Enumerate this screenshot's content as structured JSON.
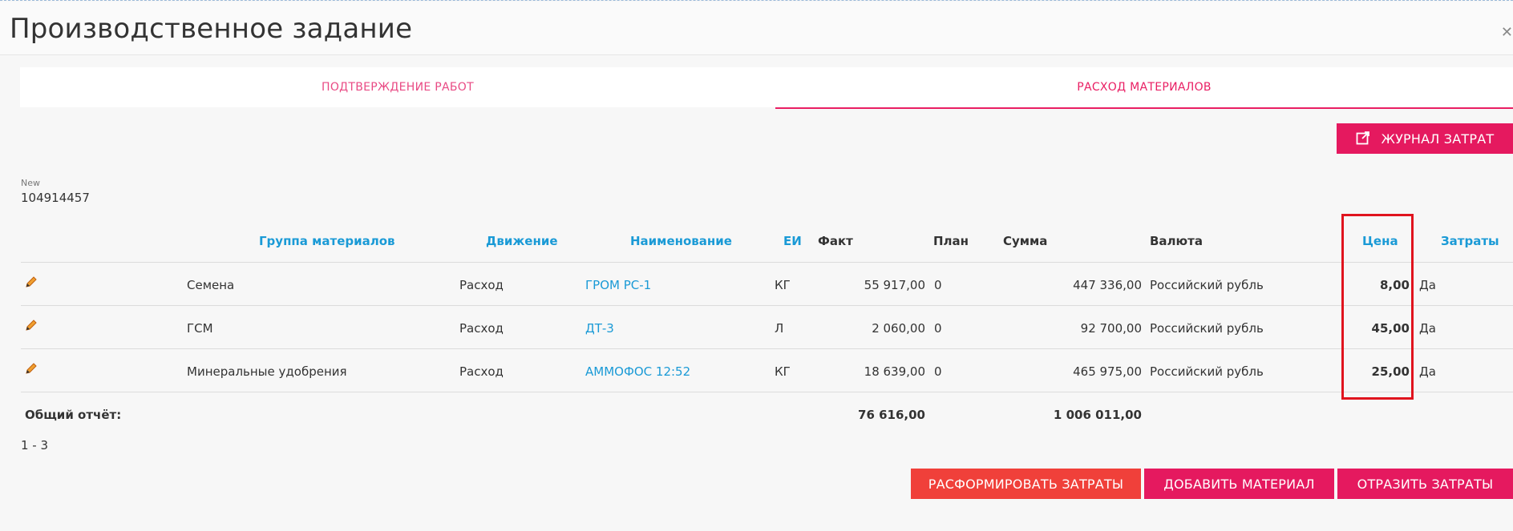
{
  "page": {
    "title": "Производственное задание"
  },
  "tabs": [
    {
      "label": "ПОДТВЕРЖДЕНИЕ РАБОТ"
    },
    {
      "label": "РАСХОД МАТЕРИАЛОВ"
    }
  ],
  "toolbar": {
    "journal_label": "ЖУРНАЛ ЗАТРАТ"
  },
  "record": {
    "label": "New",
    "value": "104914457"
  },
  "table": {
    "columns": {
      "group": "Группа материалов",
      "movement": "Движение",
      "name": "Наименование",
      "unit": "ЕИ",
      "fact": "Факт",
      "plan": "План",
      "sum": "Сумма",
      "currency": "Валюта",
      "price": "Цена",
      "costs": "Затраты"
    },
    "rows": [
      {
        "group": "Семена",
        "movement": "Расход",
        "name": "ГРОМ РС-1",
        "unit": "КГ",
        "fact": "55 917,00",
        "plan": "0",
        "sum": "447 336,00",
        "currency": "Российский рубль",
        "price": "8,00",
        "costs": "Да"
      },
      {
        "group": "ГСМ",
        "movement": "Расход",
        "name": "ДТ-3",
        "unit": "Л",
        "fact": "2 060,00",
        "plan": "0",
        "sum": "92 700,00",
        "currency": "Российский рубль",
        "price": "45,00",
        "costs": "Да"
      },
      {
        "group": "Минеральные удобрения",
        "movement": "Расход",
        "name": "АММОФОС 12:52",
        "unit": "КГ",
        "fact": "18 639,00",
        "plan": "0",
        "sum": "465 975,00",
        "currency": "Российский рубль",
        "price": "25,00",
        "costs": "Да"
      }
    ],
    "totals": {
      "label": "Общий отчёт:",
      "fact": "76 616,00",
      "sum": "1 006 011,00"
    },
    "pagination": "1 - 3"
  },
  "actions": {
    "dissolve_label": "РАСФОРМИРОВАТЬ ЗАТРАТЫ",
    "add_label": "ДОБАВИТЬ МАТЕРИАЛ",
    "reflect_label": "ОТРАЗИТЬ ЗАТРАТЫ"
  },
  "colors": {
    "accent": "#e5195f",
    "link": "#1a9ad6",
    "danger": "#f0403a",
    "highlight": "#e0141e"
  },
  "icons": {
    "edit": "pencil-icon",
    "journal": "external-link-icon",
    "close": "close-icon"
  }
}
